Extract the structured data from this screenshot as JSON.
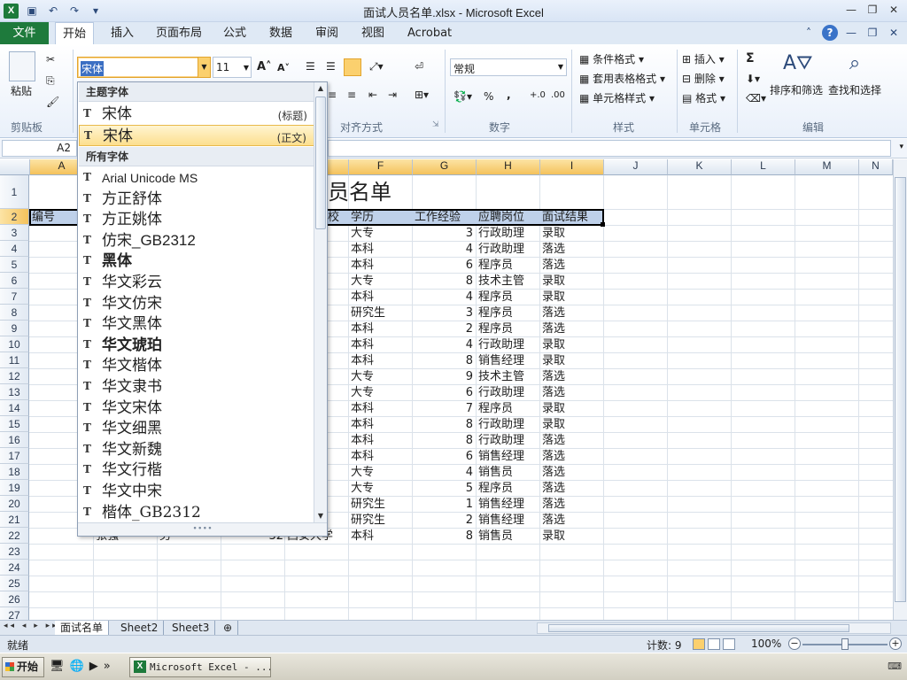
{
  "window": {
    "app_icon": "X",
    "title": "面试人员名单.xlsx - Microsoft Excel",
    "qat_icons": [
      "save-icon",
      "undo-icon",
      "redo-icon",
      "customize-qat-icon"
    ],
    "controls": [
      "—",
      "❐",
      "✕"
    ]
  },
  "ribbon_tabs": {
    "file": "文件",
    "tabs": [
      "开始",
      "插入",
      "页面布局",
      "公式",
      "数据",
      "审阅",
      "视图",
      "Acrobat"
    ],
    "active_index": 0
  },
  "ribbon": {
    "clipboard": {
      "paste": "粘贴",
      "label": "剪贴板"
    },
    "font": {
      "name": "宋体",
      "size": "11",
      "grow": "A˄",
      "shrink": "A˅"
    },
    "alignment": {
      "label": "对齐方式"
    },
    "number": {
      "format": "常规",
      "label": "数字",
      "percent": "%",
      "comma": ","
    },
    "styles": {
      "conditional": "条件格式",
      "table": "套用表格格式",
      "cell": "单元格样式",
      "label": "样式"
    },
    "cells": {
      "insert": "插入",
      "delete": "删除",
      "format": "格式",
      "label": "单元格"
    },
    "editing": {
      "sigma": "Σ",
      "sort": "排序和筛选",
      "find": "查找和选择",
      "label": "编辑"
    }
  },
  "formula_bar": {
    "name_box": "A2",
    "formula": ""
  },
  "font_dropdown": {
    "theme_header": "主题字体",
    "theme_fonts": [
      {
        "name": "宋体",
        "tag": "(标题)"
      },
      {
        "name": "宋体",
        "tag": "(正文)"
      }
    ],
    "all_header": "所有字体",
    "fonts": [
      "Arial Unicode MS",
      "方正舒体",
      "方正姚体",
      "仿宋_GB2312",
      "黑体",
      "华文彩云",
      "华文仿宋",
      "华文黑体",
      "华文琥珀",
      "华文楷体",
      "华文隶书",
      "华文宋体",
      "华文细黑",
      "华文新魏",
      "华文行楷",
      "华文中宋",
      "楷体_GB2312"
    ]
  },
  "sheet": {
    "columns": [
      "A",
      "B",
      "C",
      "D",
      "E",
      "F",
      "G",
      "H",
      "I",
      "J",
      "K",
      "L",
      "M",
      "N"
    ],
    "selected_columns": [
      "A",
      "B",
      "C",
      "D",
      "E",
      "F",
      "G",
      "H",
      "I"
    ],
    "title_visible": "员名单",
    "header_row": {
      "A": "编号",
      "E": "校",
      "F": "学历",
      "G": "工作经验",
      "H": "应聘岗位",
      "I": "面试结果"
    },
    "rows": [
      {
        "row": 3,
        "E": "学",
        "F": "大专",
        "G": "3",
        "H": "行政助理",
        "I": "录取"
      },
      {
        "row": 4,
        "E": "学",
        "F": "本科",
        "G": "4",
        "H": "行政助理",
        "I": "落选"
      },
      {
        "row": 5,
        "E": "通大",
        "F": "本科",
        "G": "6",
        "H": "程序员",
        "I": "落选"
      },
      {
        "row": 6,
        "E": "通大",
        "F": "大专",
        "G": "8",
        "H": "技术主管",
        "I": "录取"
      },
      {
        "row": 7,
        "E": "学",
        "F": "本科",
        "G": "4",
        "H": "程序员",
        "I": "录取"
      },
      {
        "row": 8,
        "E": "学",
        "F": "研究生",
        "G": "3",
        "H": "程序员",
        "I": "落选"
      },
      {
        "row": 9,
        "E": "子科",
        "F": "本科",
        "G": "2",
        "H": "程序员",
        "I": "落选"
      },
      {
        "row": 10,
        "E": "学",
        "F": "本科",
        "G": "4",
        "H": "行政助理",
        "I": "录取"
      },
      {
        "row": 11,
        "E": "学",
        "F": "本科",
        "G": "8",
        "H": "销售经理",
        "I": "录取"
      },
      {
        "row": 12,
        "E": "通大",
        "F": "大专",
        "G": "9",
        "H": "技术主管",
        "I": "落选"
      },
      {
        "row": 13,
        "E": "子科",
        "F": "大专",
        "G": "6",
        "H": "行政助理",
        "I": "落选"
      },
      {
        "row": 14,
        "E": "学",
        "F": "本科",
        "G": "7",
        "H": "程序员",
        "I": "录取"
      },
      {
        "row": 15,
        "E": "学",
        "F": "本科",
        "G": "8",
        "H": "行政助理",
        "I": "录取"
      },
      {
        "row": 16,
        "E": "学",
        "F": "本科",
        "G": "8",
        "H": "行政助理",
        "I": "落选"
      },
      {
        "row": 17,
        "E": "通大",
        "F": "本科",
        "G": "6",
        "H": "销售经理",
        "I": "落选"
      },
      {
        "row": 18,
        "E": "子科",
        "F": "大专",
        "G": "4",
        "H": "销售员",
        "I": "落选"
      },
      {
        "row": 19,
        "E": "学",
        "F": "大专",
        "G": "5",
        "H": "程序员",
        "I": "落选"
      },
      {
        "row": 20,
        "E": "通大",
        "F": "研究生",
        "G": "1",
        "H": "销售经理",
        "I": "落选"
      },
      {
        "row": 21,
        "E": "学",
        "F": "研究生",
        "G": "2",
        "H": "销售经理",
        "I": "落选"
      },
      {
        "row": 22,
        "B": "张强",
        "C": "男",
        "D": "32",
        "E": "西安大学",
        "F": "本科",
        "G": "8",
        "H": "销售员",
        "I": "录取"
      }
    ],
    "row_numbers": [
      "1",
      "2",
      "3",
      "4",
      "5",
      "6",
      "7",
      "8",
      "9",
      "10",
      "11",
      "12",
      "13",
      "14",
      "15",
      "16",
      "17",
      "18",
      "19",
      "20",
      "21",
      "22",
      "23",
      "24",
      "25",
      "26",
      "27"
    ]
  },
  "sheet_tabs": {
    "tabs": [
      "面试名单",
      "Sheet2",
      "Sheet3"
    ],
    "active_index": 0,
    "nav": "◂◂ ◂ ▸ ▸▸"
  },
  "status": {
    "ready": "就绪",
    "count": "计数: 9",
    "zoom": "100%",
    "minus": "−",
    "plus": "+"
  },
  "taskbar": {
    "start": "开始",
    "task": "Microsoft Excel - ...",
    "chevron": "»"
  }
}
